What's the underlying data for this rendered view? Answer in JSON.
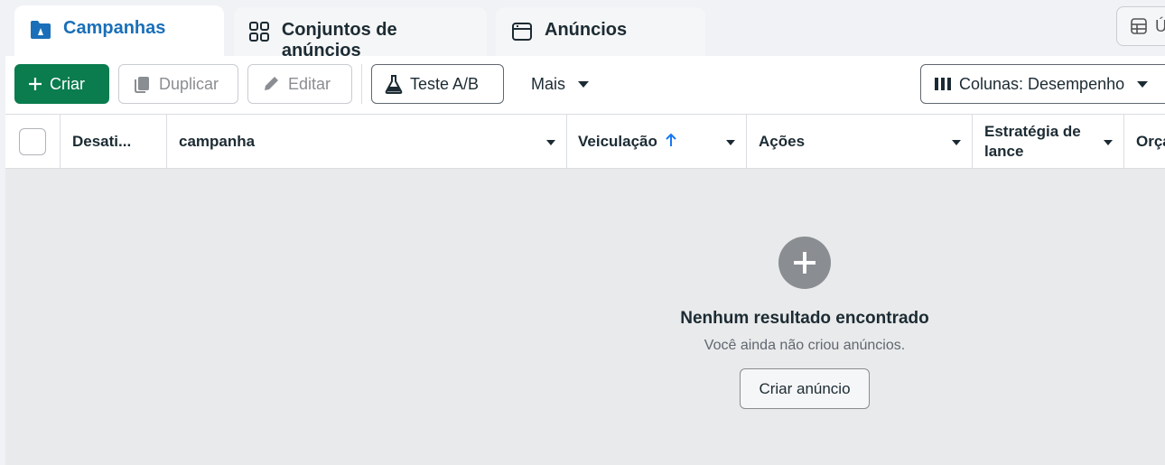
{
  "tabs": [
    {
      "label": "Campanhas",
      "icon": "folder-icon",
      "active": true
    },
    {
      "label": "Conjuntos de anúncios",
      "icon": "grid-icon",
      "active": false
    },
    {
      "label": "Anúncios",
      "icon": "window-icon",
      "active": false
    }
  ],
  "corner_button": {
    "label": "Ú",
    "icon": "table-icon"
  },
  "toolbar": {
    "create_label": "Criar",
    "duplicate_label": "Duplicar",
    "edit_label": "Editar",
    "ab_test_label": "Teste A/B",
    "more_label": "Mais",
    "columns_label": "Colunas: Desempenho"
  },
  "table": {
    "columns": [
      {
        "label": "Desati..."
      },
      {
        "label": "campanha"
      },
      {
        "label": "Veiculação"
      },
      {
        "label": "Ações"
      },
      {
        "label": "Estratégia de lance"
      },
      {
        "label": "Orça"
      }
    ]
  },
  "empty_state": {
    "title": "Nenhum resultado encontrado",
    "subtitle": "Você ainda não criou anúncios.",
    "button_label": "Criar anúncio"
  },
  "colors": {
    "accent": "#1a6fb8",
    "create_button": "#0a7c4e",
    "sort_arrow": "#1877f2"
  }
}
